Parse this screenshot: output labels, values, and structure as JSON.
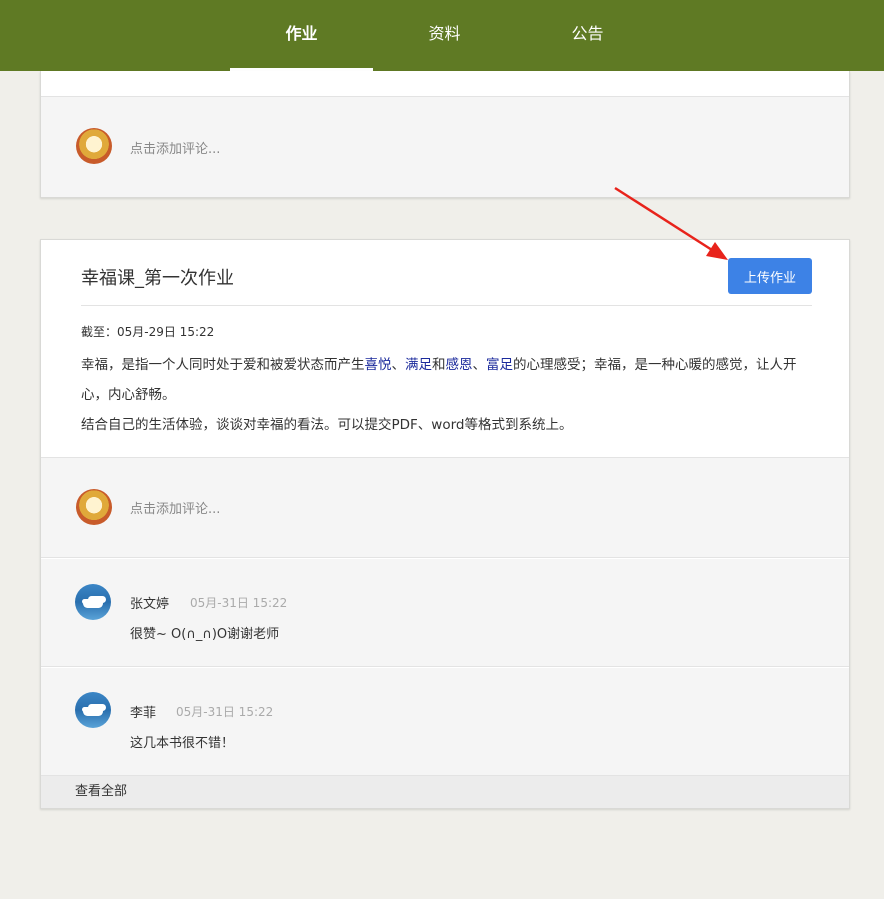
{
  "nav": {
    "tabs": [
      {
        "label": "作业",
        "active": true
      },
      {
        "label": "资料",
        "active": false
      },
      {
        "label": "公告",
        "active": false
      }
    ],
    "bg_color": "#5f7a24"
  },
  "top_card": {
    "comment_placeholder": "点击添加评论..."
  },
  "assignment": {
    "title": "幸福课_第一次作业",
    "upload_label": "上传作业",
    "deadline": "截至：05月-29日  15:22",
    "desc": {
      "p1_a": "幸福，是指一个人同时处于爱和被爱状态而产生",
      "hl1": "喜悦",
      "sep1": "、",
      "hl2": "满足",
      "and": "和",
      "hl3": "感恩",
      "sep2": "、",
      "hl4": "富足",
      "p1_b": "的心理感受；幸福，是一种心暖的感觉，让人开心，内心舒畅。",
      "p2": "结合自己的生活体验，谈谈对幸福的看法。可以提交PDF、word等格式到系统上。"
    },
    "comment_placeholder": "点击添加评论...",
    "comments": [
      {
        "name": "张文婷",
        "time": "05月-31日 15:22",
        "text": "很赞~ O(∩_∩)O谢谢老师"
      },
      {
        "name": "李菲",
        "time": "05月-31日 15:22",
        "text": "这几本书很不错！"
      }
    ],
    "view_all": "查看全部"
  },
  "colors": {
    "upload_button": "#3d82e6",
    "highlight_text": "#1b2a9c",
    "annotation_arrow": "#e8231b"
  }
}
